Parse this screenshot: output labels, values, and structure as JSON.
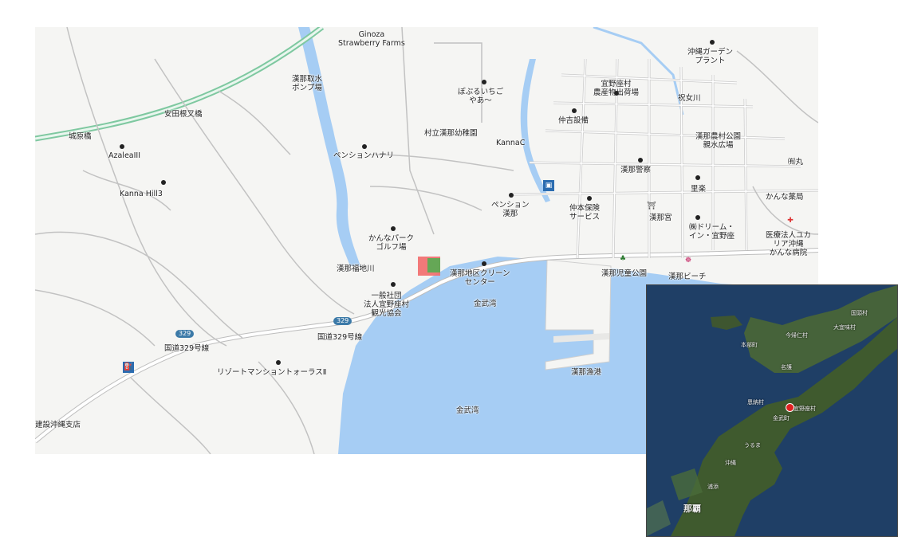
{
  "map": {
    "places": [
      {
        "id": "ginoza-strawberry",
        "text": "Ginoza\nStrawberry Farms"
      },
      {
        "id": "nago-intake",
        "text": "漢那取水\nポンプ場"
      },
      {
        "id": "okinawa-garden",
        "text": "沖縄ガーデン\nプラント"
      },
      {
        "id": "pupuru",
        "text": "ぽぷるいちご\nやあ〜"
      },
      {
        "id": "ginoza-farm-shop",
        "text": "宜野座村\n農産物出荷場"
      },
      {
        "id": "iwaijogawa",
        "text": "祝女川"
      },
      {
        "id": "yasuda-bridge",
        "text": "安田根叉橋"
      },
      {
        "id": "nakayoshi",
        "text": "仲吉設備"
      },
      {
        "id": "ginoza-park",
        "text": "漢那農村公園\n親水広場"
      },
      {
        "id": "kindergarten",
        "text": "村立漢那幼稚園"
      },
      {
        "id": "kannac",
        "text": "KannaC"
      },
      {
        "id": "joharabashi",
        "text": "城原橋"
      },
      {
        "id": "azalea",
        "text": "AzaleaIII"
      },
      {
        "id": "pension-hanari",
        "text": "ペンションハナリ"
      },
      {
        "id": "kanna-kei",
        "text": "漢那警察"
      },
      {
        "id": "maru",
        "text": "㈲丸"
      },
      {
        "id": "kanna-hill",
        "text": "Kanna Hill3"
      },
      {
        "id": "pension-kanna",
        "text": "ペンション\n漢那"
      },
      {
        "id": "satoraku",
        "text": "里楽"
      },
      {
        "id": "kanna-yakkyoku",
        "text": "かんな薬局"
      },
      {
        "id": "nakamoto-hoken",
        "text": "仲本保険\nサービス"
      },
      {
        "id": "kanna-miya",
        "text": "漢那宮"
      },
      {
        "id": "dream-inn",
        "text": "㈱ドリーム・\nイン・宜野座"
      },
      {
        "id": "kanna-park-golf",
        "text": "かんなパーク\nゴルフ場"
      },
      {
        "id": "yukari-hospital",
        "text": "医療法人ユカ\nリア沖縄\nかんな病院"
      },
      {
        "id": "kanna-fukuchi",
        "text": "漢那福地川"
      },
      {
        "id": "clean-center",
        "text": "漢那地区クリーン\nセンター"
      },
      {
        "id": "kanna-jido-park",
        "text": "漢那児童公園"
      },
      {
        "id": "kanna-beach",
        "text": "漢那ビーチ"
      },
      {
        "id": "kankokyokai",
        "text": "一般社団\n法人宜野座村\n観光協会"
      },
      {
        "id": "kinwan-1",
        "text": "金武湾"
      },
      {
        "id": "route329-shield",
        "text": "329"
      },
      {
        "id": "route329-a",
        "text": "国道329号線"
      },
      {
        "id": "route329-b",
        "text": "国道329号線"
      },
      {
        "id": "resort-mansion",
        "text": "リゾートマンショントォーラスⅡ"
      },
      {
        "id": "kanna-fishing-port",
        "text": "漢那漁港"
      },
      {
        "id": "kinwan-2",
        "text": "金武湾"
      },
      {
        "id": "kensetsu",
        "text": "建設沖縄支店"
      },
      {
        "id": "route329-shield-2",
        "text": "329"
      }
    ]
  },
  "inset": {
    "labels": {
      "kunigami": "国頭村",
      "ogimi": "大宜味村",
      "nakijin": "今帰仁村",
      "motobu": "本部町",
      "nago": "名護",
      "onna": "恩納村",
      "ginoza": "宜野座村",
      "kin": "金武町",
      "uruma": "うるま",
      "okinawa_city": "沖縄",
      "naha": "那覇",
      "urasoe": "浦添"
    },
    "marker_color": "#e02020"
  },
  "colors": {
    "land": "#f5f5f3",
    "sea": "#a6cdf4",
    "road": "#ffffff",
    "road_outline": "#bdbdbd",
    "expressway": "#7ec8a0",
    "river": "#a6cdf4"
  }
}
